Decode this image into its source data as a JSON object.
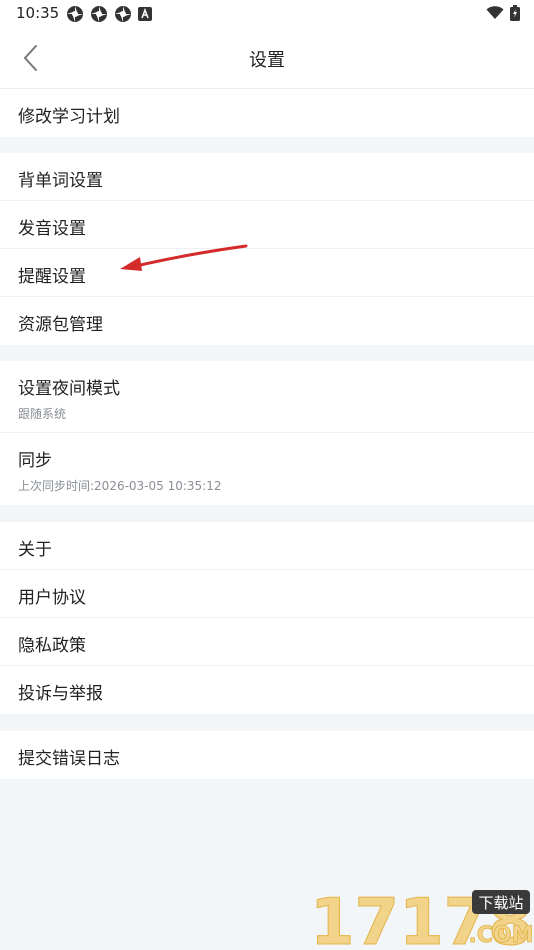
{
  "status": {
    "time": "10:35",
    "notification_icons": [
      "pinwheel-icon",
      "pinwheel-icon",
      "pinwheel-icon",
      "a-icon"
    ],
    "right_icons": [
      "wifi-icon",
      "battery-charging-icon"
    ]
  },
  "header": {
    "title": "设置",
    "back_icon": "chevron-left-icon"
  },
  "groups": [
    {
      "items": [
        {
          "label": "修改学习计划"
        }
      ]
    },
    {
      "items": [
        {
          "label": "背单词设置"
        },
        {
          "label": "发音设置"
        },
        {
          "label": "提醒设置"
        },
        {
          "label": "资源包管理"
        }
      ]
    },
    {
      "items": [
        {
          "label": "设置夜间模式",
          "sub": "跟随系统"
        },
        {
          "label": "同步",
          "sub": "上次同步时间:2026-03-05 10:35:12"
        }
      ]
    },
    {
      "items": [
        {
          "label": "关于"
        },
        {
          "label": "用户协议"
        },
        {
          "label": "隐私政策"
        },
        {
          "label": "投诉与举报"
        }
      ]
    },
    {
      "items": [
        {
          "label": "提交错误日志"
        }
      ]
    }
  ],
  "annotation": {
    "arrow_icon": "red-arrow-icon",
    "color": "#d42a2a"
  },
  "watermark": {
    "digits": "17178",
    "badge": "下载站",
    "domain": ".COM"
  },
  "colors": {
    "background": "#f3f6f9",
    "row": "#ffffff",
    "text": "#222222",
    "subtext": "#8a8f96"
  }
}
